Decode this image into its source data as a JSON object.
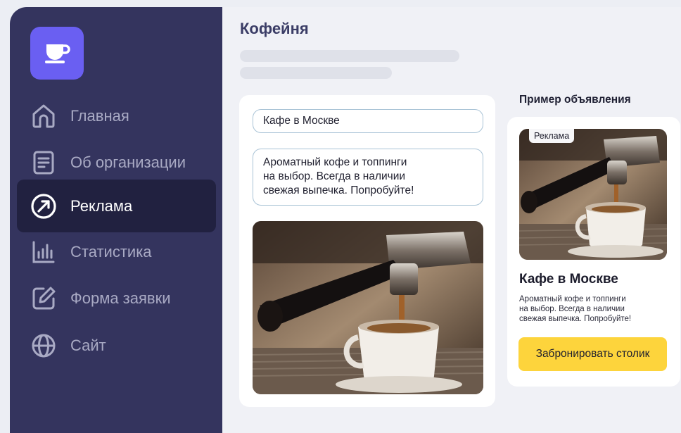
{
  "app": {
    "logo_icon": "coffee-cup-icon",
    "brand_color": "#6a5ff2"
  },
  "sidebar": {
    "items": [
      {
        "label": "Главная",
        "icon": "home-icon",
        "active": false
      },
      {
        "label": "Об организации",
        "icon": "document-icon",
        "active": false
      },
      {
        "label": "Реклама",
        "icon": "arrow-circle-icon",
        "active": true
      },
      {
        "label": "Статистика",
        "icon": "bar-chart-icon",
        "active": false
      },
      {
        "label": "Форма заявки",
        "icon": "edit-form-icon",
        "active": false
      },
      {
        "label": "Сайт",
        "icon": "globe-icon",
        "active": false
      }
    ]
  },
  "main": {
    "title": "Кофейня",
    "editor": {
      "title_value": "Кафе в Москве",
      "description_value": "Ароматный кофе и топпинги\nна выбор. Всегда в наличии\nсвежая выпечка. Попробуйте!"
    },
    "preview": {
      "heading": "Пример объявления",
      "badge": "Реклама",
      "title": "Кафе в Москве",
      "description": "Ароматный кофе и топпинги\nна выбор. Всегда в наличии\nсвежая выпечка. Попробуйте!",
      "cta_label": "Забронировать столик",
      "cta_color": "#fdd43c"
    }
  }
}
